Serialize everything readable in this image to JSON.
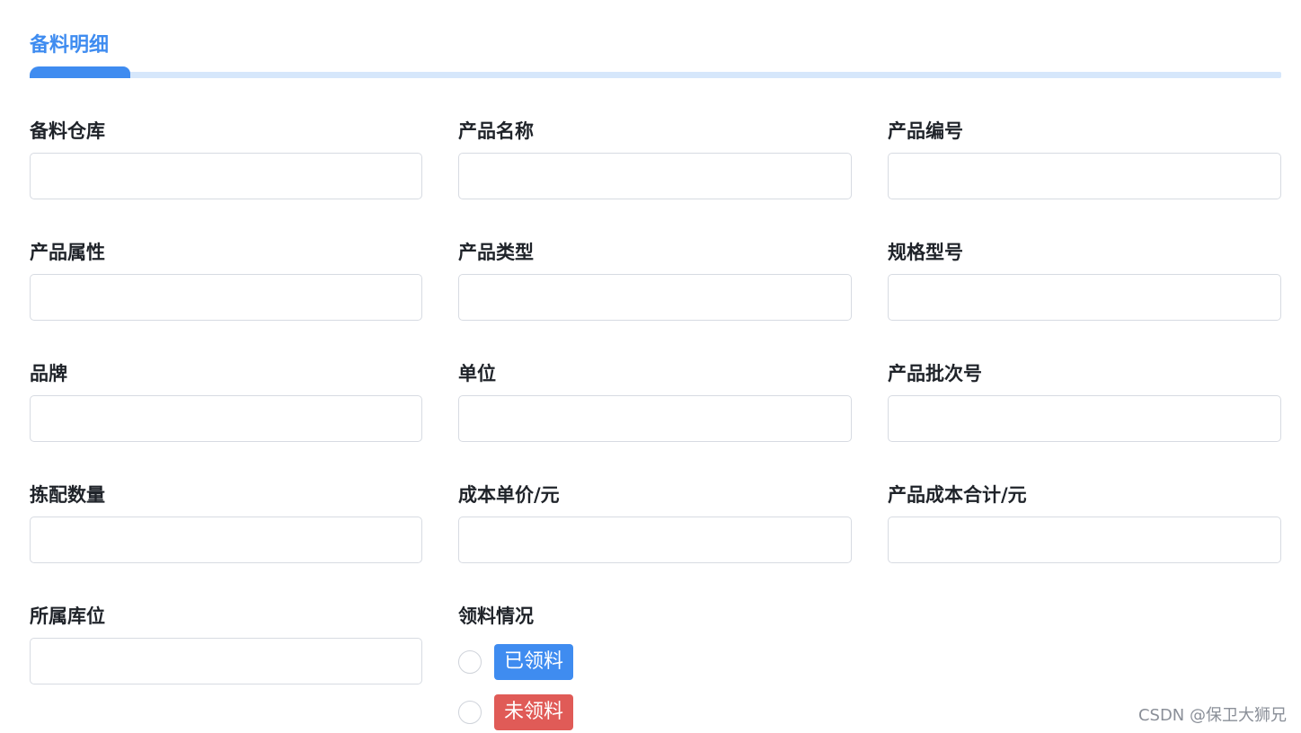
{
  "section": {
    "title": "备料明细"
  },
  "fields": {
    "warehouse": {
      "label": "备料仓库",
      "value": "",
      "placeholder": ""
    },
    "product_name": {
      "label": "产品名称",
      "value": "",
      "placeholder": ""
    },
    "product_code": {
      "label": "产品编号",
      "value": "",
      "placeholder": ""
    },
    "product_attr": {
      "label": "产品属性",
      "value": "",
      "placeholder": ""
    },
    "product_type": {
      "label": "产品类型",
      "value": "",
      "placeholder": ""
    },
    "spec_model": {
      "label": "规格型号",
      "value": "",
      "placeholder": ""
    },
    "brand": {
      "label": "品牌",
      "value": "",
      "placeholder": ""
    },
    "unit": {
      "label": "单位",
      "value": "",
      "placeholder": ""
    },
    "batch_no": {
      "label": "产品批次号",
      "value": "",
      "placeholder": ""
    },
    "pick_qty": {
      "label": "拣配数量",
      "value": "",
      "placeholder": ""
    },
    "unit_cost": {
      "label": "成本单价/元",
      "value": "",
      "placeholder": ""
    },
    "total_cost": {
      "label": "产品成本合计/元",
      "value": "",
      "placeholder": ""
    },
    "location": {
      "label": "所属库位",
      "value": "",
      "placeholder": ""
    }
  },
  "pickup_status": {
    "label": "领料情况",
    "options": [
      {
        "label": "已领料",
        "color": "#3f8cf0",
        "checked": false
      },
      {
        "label": "未领料",
        "color": "#e05b57",
        "checked": false
      }
    ]
  },
  "watermark": "CSDN @保卫大狮兄",
  "colors": {
    "accent": "#3f8cf0",
    "accent_light": "#d6e7fb",
    "danger": "#e05b57"
  }
}
